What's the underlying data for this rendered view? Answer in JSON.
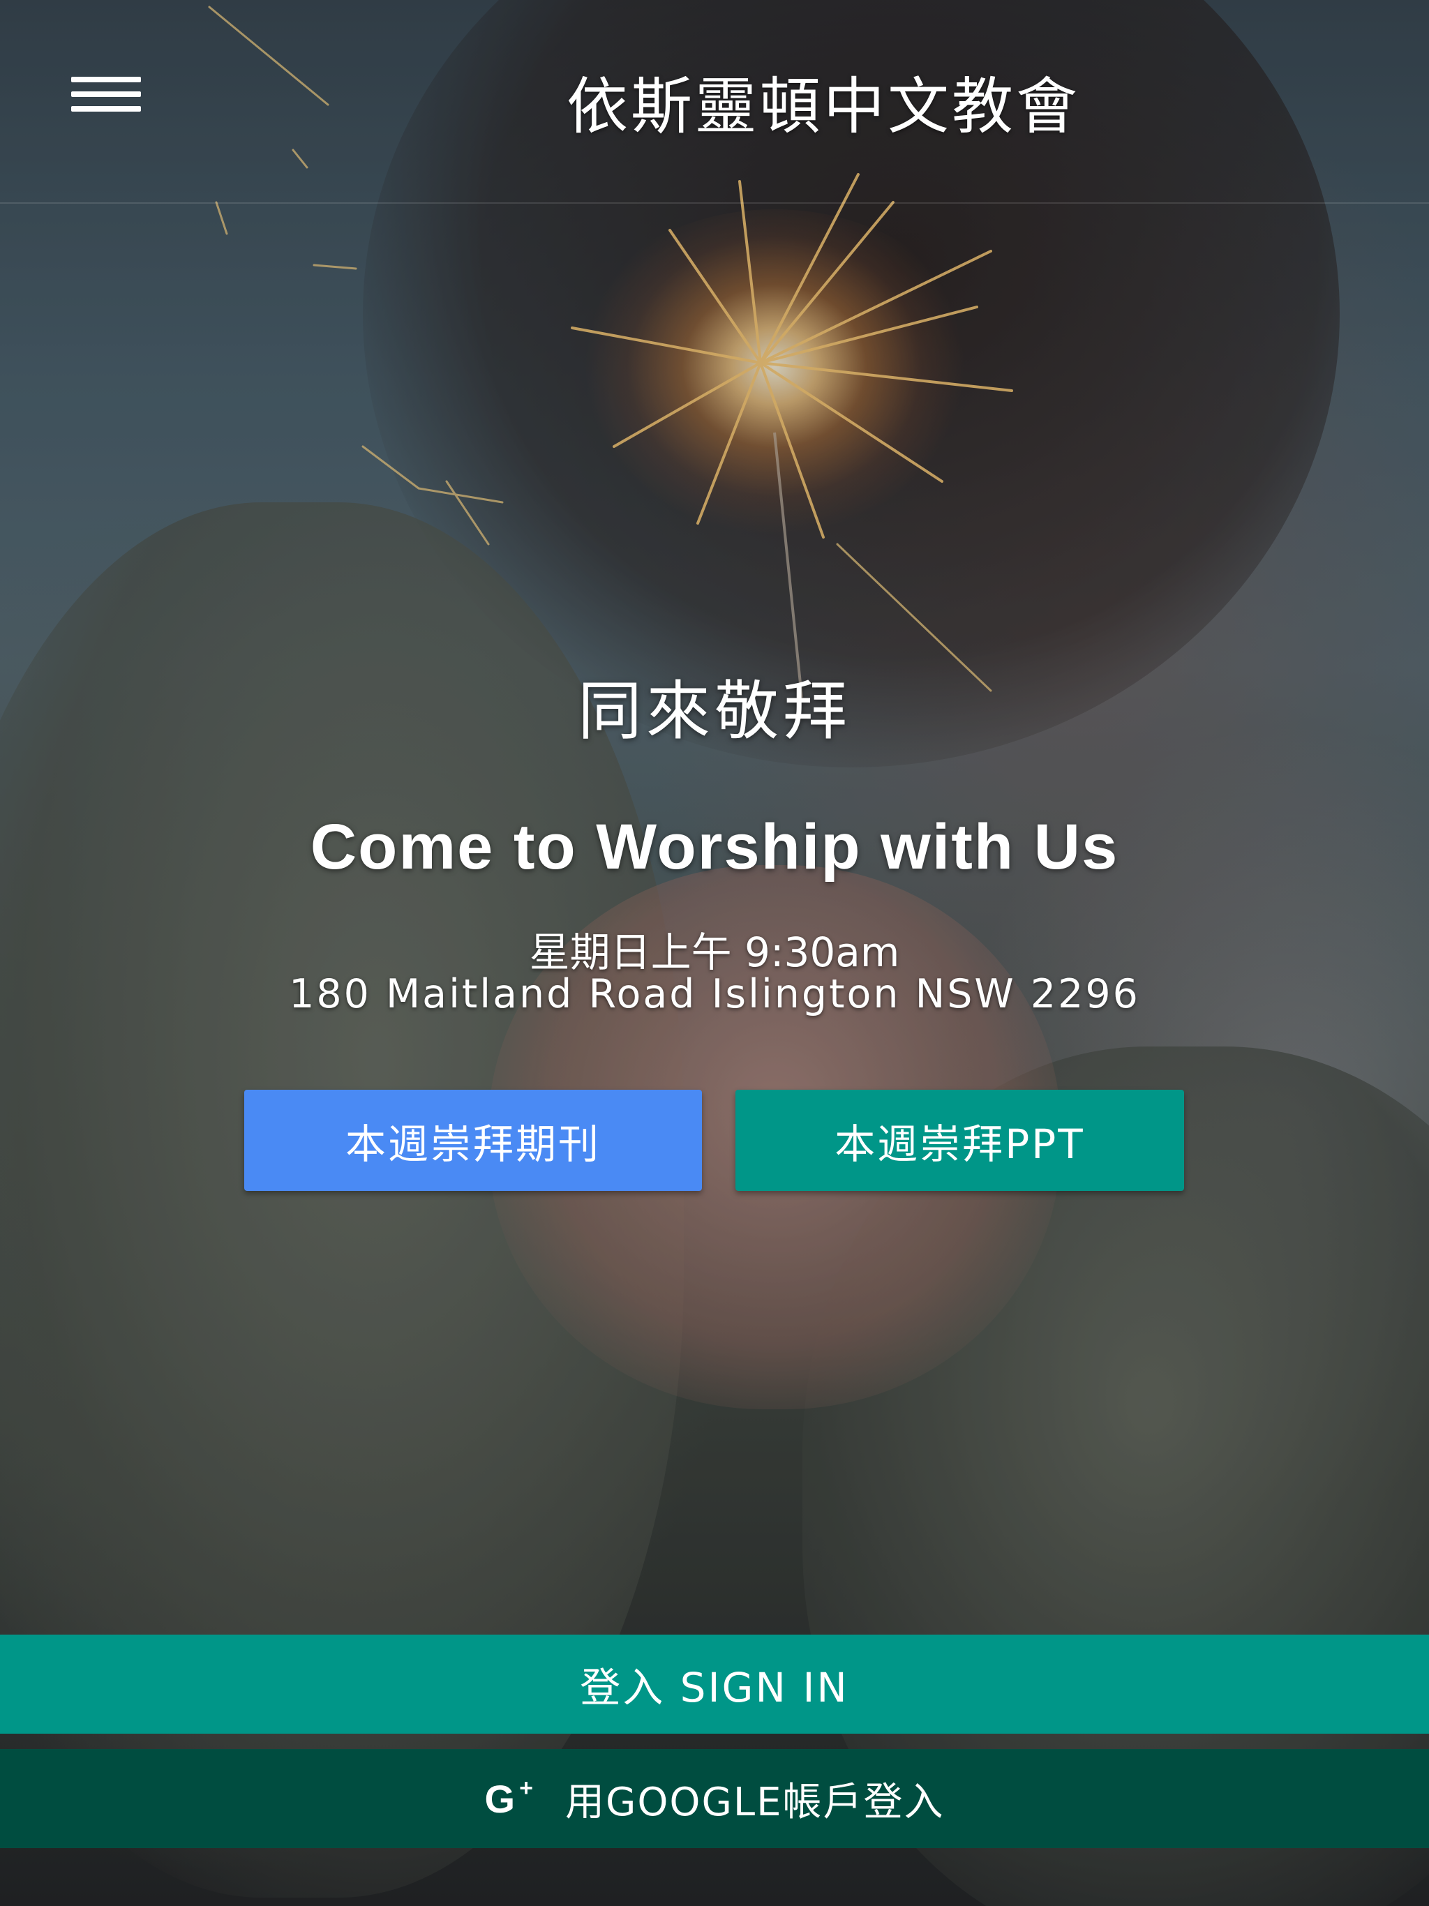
{
  "header": {
    "menu_icon": "hamburger-menu-icon",
    "title": "依斯靈頓中文教會"
  },
  "hero": {
    "heading_cn": "同來敬拜",
    "heading_en": "Come to Worship with Us",
    "service_time": "星期日上午 9:30am",
    "address": "180 Maitland Road Islington NSW 2296"
  },
  "buttons": {
    "bulletin_label": "本週崇拜期刊",
    "ppt_label": "本週崇拜PPT"
  },
  "auth": {
    "signin_label": "登入 SIGN IN",
    "google_icon": "google-plus-icon",
    "google_icon_text": "G",
    "google_icon_plus": "+",
    "google_label": "用GOOGLE帳戶登入"
  },
  "colors": {
    "primary_blue": "#4a8af4",
    "teal": "#009688",
    "dark_teal": "#004d40"
  }
}
